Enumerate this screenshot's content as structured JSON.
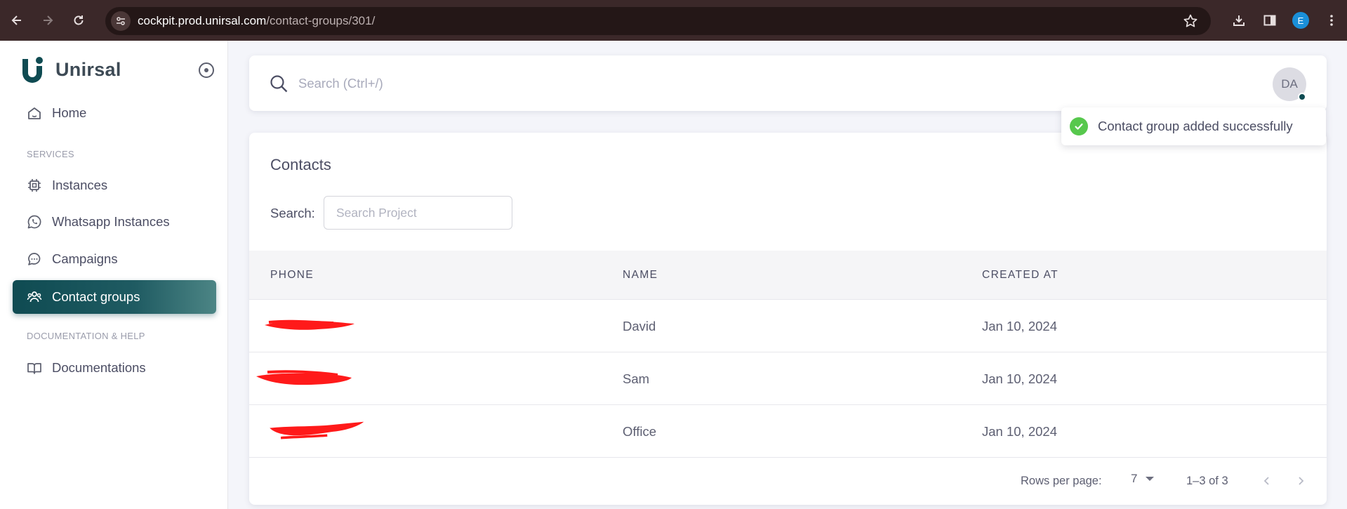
{
  "browser": {
    "url_host": "cockpit.prod.unirsal.com",
    "url_path": "/contact-groups/301/",
    "profile_initial": "E"
  },
  "sidebar": {
    "brand": "Unirsal",
    "home_label": "Home",
    "services_label": "SERVICES",
    "items": [
      {
        "label": "Instances",
        "icon": "chip-icon"
      },
      {
        "label": "Whatsapp Instances",
        "icon": "whatsapp-icon"
      },
      {
        "label": "Campaigns",
        "icon": "chat-bubble-icon"
      },
      {
        "label": "Contact groups",
        "icon": "users-icon",
        "active": true
      }
    ],
    "docs_section_label": "DOCUMENTATION & HELP",
    "docs_label": "Documentations"
  },
  "topbar": {
    "search_placeholder": "Search (Ctrl+/)",
    "avatar_initials": "DA"
  },
  "toast": {
    "message": "Contact group added successfully"
  },
  "contacts": {
    "title": "Contacts",
    "search_label": "Search:",
    "search_placeholder": "Search Project",
    "columns": [
      "PHONE",
      "NAME",
      "CREATED AT"
    ],
    "rows": [
      {
        "name": "David",
        "created_at": "Jan 10, 2024"
      },
      {
        "name": "Sam",
        "created_at": "Jan 10, 2024"
      },
      {
        "name": "Office",
        "created_at": "Jan 10, 2024"
      }
    ],
    "rows_per_page_label": "Rows per page:",
    "rows_per_page": "7",
    "range": "1–3 of 3"
  },
  "colors": {
    "brand": "#0f4b52",
    "success": "#57c84d",
    "redaction": "#ff0000"
  }
}
